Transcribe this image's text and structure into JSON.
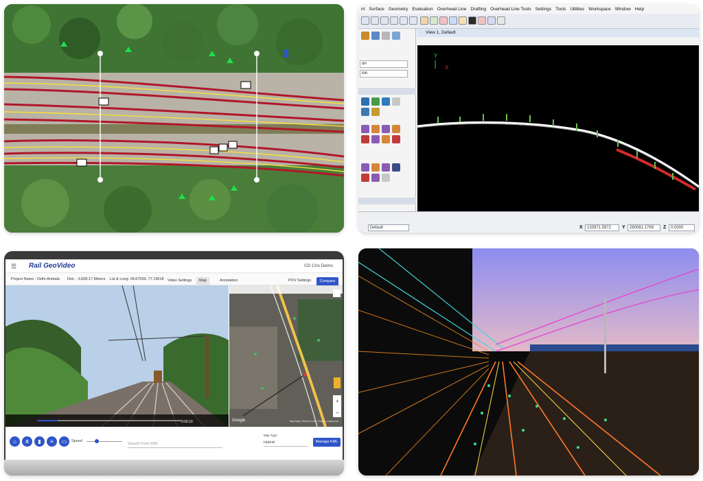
{
  "cad": {
    "menu": [
      "nt",
      "Surface",
      "Geometry",
      "Evaluation",
      "Overhead Line",
      "Drafting",
      "Overhead Line Tools",
      "Settings",
      "Tools",
      "Utilities",
      "Workspace",
      "Window",
      "Help"
    ],
    "view_title": "View 1, Default",
    "left_rows": [
      "on",
      "ion"
    ],
    "level_value": "Default",
    "x_label": "X",
    "x_value": "133971.5972",
    "y_label": "Y",
    "y_value": "280081.1769",
    "z_label": "Z",
    "z_value": "0.0000"
  },
  "geovideo": {
    "title": "Rail GeoVideo",
    "user": "CD   Cris Demo",
    "project": "Project Name : Delhi-Ambala",
    "dist": "Dist. : 3,608.17 Meters",
    "latlong": "Lat & Long: 28.67099, 77.19618",
    "tabs": [
      "Video Settings",
      "Map",
      "Annotation"
    ],
    "pov": "POV Settings",
    "compare": "Compare",
    "speed_label": "Speed",
    "search_placeholder": "Search From KML",
    "map_type_label": "Map Type",
    "map_type_value": "Hybrid",
    "manage_kml": "Manage KML",
    "video_time": "0:00:10",
    "map_google": "Google",
    "map_footer": "Map Data | Terms of Use | Report a map error"
  },
  "colors": {
    "brand_blue": "#2f55c9",
    "rail_red": "#b0162a",
    "rail_yellow": "#f3e13a",
    "cad_track_green": "#6cc24a"
  }
}
